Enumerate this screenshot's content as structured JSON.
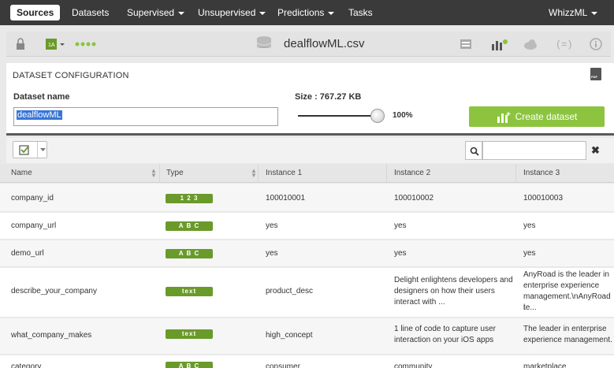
{
  "nav": {
    "active": "Sources",
    "items": [
      {
        "label": "Datasets",
        "caret": false
      },
      {
        "label": "Supervised",
        "caret": true
      },
      {
        "label": "Unsupervised",
        "caret": true
      },
      {
        "label": "Predictions",
        "caret": true
      },
      {
        "label": "Tasks",
        "caret": false
      }
    ],
    "user": "WhizzML"
  },
  "toolbar": {
    "filename": "dealflowML.csv",
    "icons": [
      "lock-icon",
      "source-type-icon",
      "dots-icon",
      "database-icon",
      "configure-icon",
      "dataset-icon",
      "cloud-icon",
      "script-icon",
      "info-icon"
    ]
  },
  "config": {
    "title": "DATASET CONFIGURATION",
    "name_label": "Dataset name",
    "name_value": "dealflowML",
    "size_label": "Size : 767.27 KB",
    "percent": "100%",
    "create_label": "Create dataset",
    "accent": "#8cc43f"
  },
  "table": {
    "headers": [
      "Name",
      "Type",
      "Instance 1",
      "Instance 2",
      "Instance 3"
    ],
    "rows": [
      {
        "name": "company_id",
        "type": "1 2 3",
        "i1": "100010001",
        "i2": [
          "100010002"
        ],
        "i3": [
          "100010003"
        ]
      },
      {
        "name": "company_url",
        "type": "A B C",
        "i1": "yes",
        "i2": [
          "yes"
        ],
        "i3": [
          "yes"
        ]
      },
      {
        "name": "demo_url",
        "type": "A B C",
        "i1": "yes",
        "i2": [
          "yes"
        ],
        "i3": [
          "yes"
        ]
      },
      {
        "name": "describe_your_company",
        "type": "text",
        "i1": "product_desc",
        "i2": [
          "Delight enlightens developers and",
          "designers on how their users",
          "interact with ..."
        ],
        "i3": [
          "AnyRoad is the leader in",
          "enterprise experience",
          "management.\\nAnyRoad i",
          "te..."
        ]
      },
      {
        "name": "what_company_makes",
        "type": "text",
        "i1": "high_concept",
        "i2": [
          "1 line of code to capture user",
          "interaction on your iOS apps"
        ],
        "i3": [
          "The leader in enterprise",
          "experience management."
        ]
      },
      {
        "name": "category",
        "type": "A B C",
        "i1": "consumer",
        "i2": [
          "community"
        ],
        "i3": [
          "marketplace"
        ]
      }
    ]
  }
}
